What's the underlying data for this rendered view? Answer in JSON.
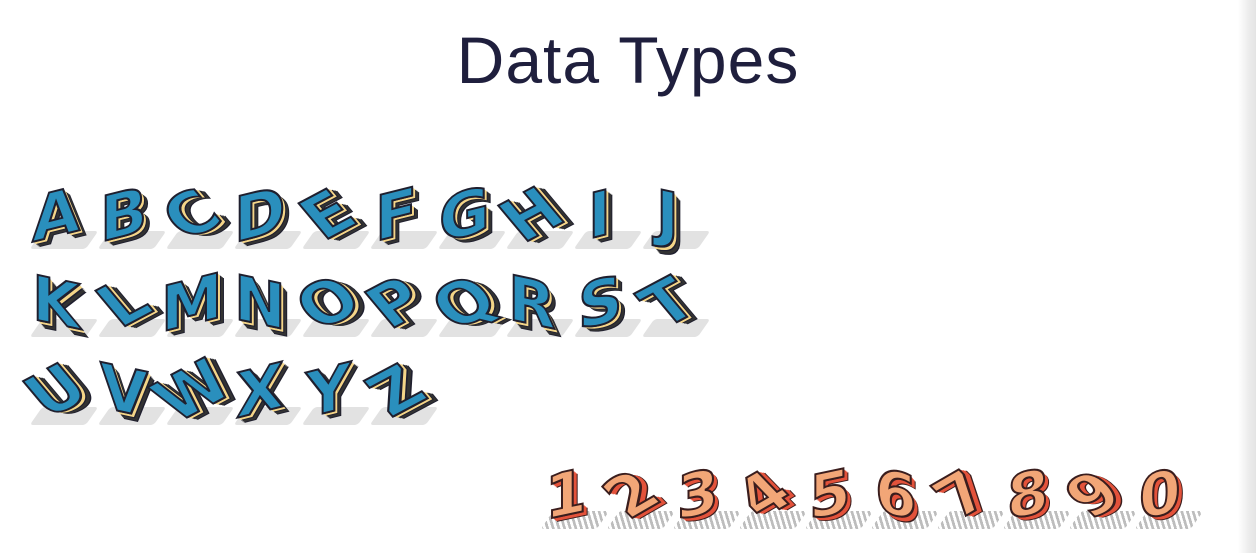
{
  "title": "Data Types",
  "letters": {
    "row1": [
      "A",
      "B",
      "C",
      "D",
      "E",
      "F",
      "G",
      "H",
      "I",
      "J"
    ],
    "row2": [
      "K",
      "L",
      "M",
      "N",
      "O",
      "P",
      "Q",
      "R",
      "S",
      "T"
    ],
    "row3": [
      "U",
      "V",
      "W",
      "X",
      "Y",
      "Z"
    ]
  },
  "numbers": [
    "1",
    "2",
    "3",
    "4",
    "5",
    "6",
    "7",
    "8",
    "9",
    "0"
  ],
  "colors": {
    "title": "#1f1f3d",
    "letter_face": "#2a8fbd",
    "letter_top": "#f4d588",
    "letter_side": "#333333",
    "number_face": "#f2a677",
    "number_side": "#e3523b",
    "outline": "#1f1f2e"
  }
}
